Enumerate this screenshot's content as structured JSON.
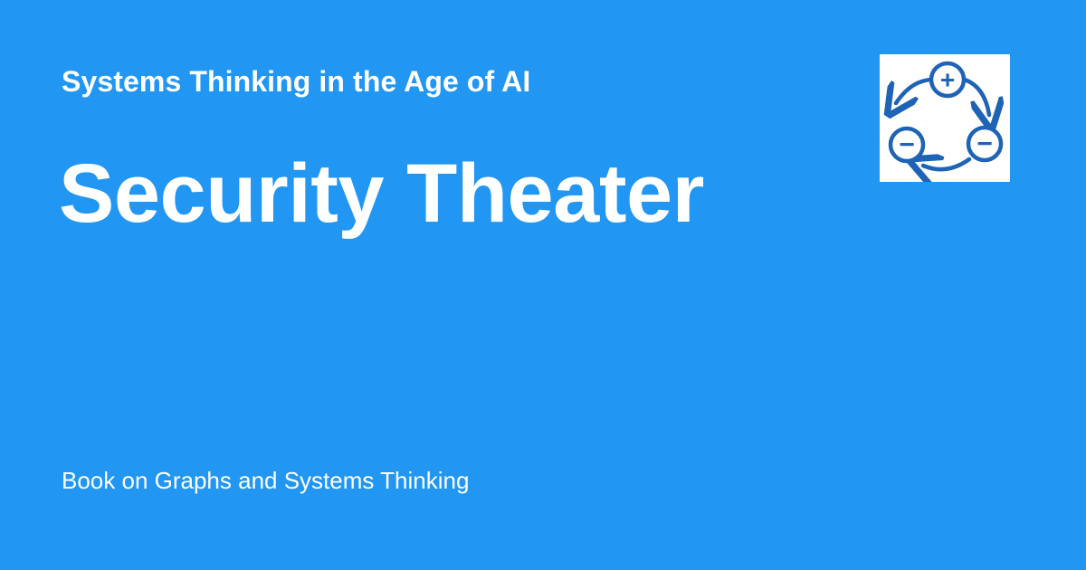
{
  "header": {
    "series_title": "Systems Thinking in the Age of AI"
  },
  "main": {
    "title": "Security Theater"
  },
  "footer": {
    "book_label": "Book on Graphs and Systems Thinking"
  },
  "logo": {
    "icon": "feedback-loop-icon",
    "nodes": [
      "+",
      "−",
      "−"
    ],
    "color": "#1e63b5"
  },
  "colors": {
    "background": "#2196f3",
    "text": "#ffffff",
    "logo_background": "#ffffff"
  }
}
